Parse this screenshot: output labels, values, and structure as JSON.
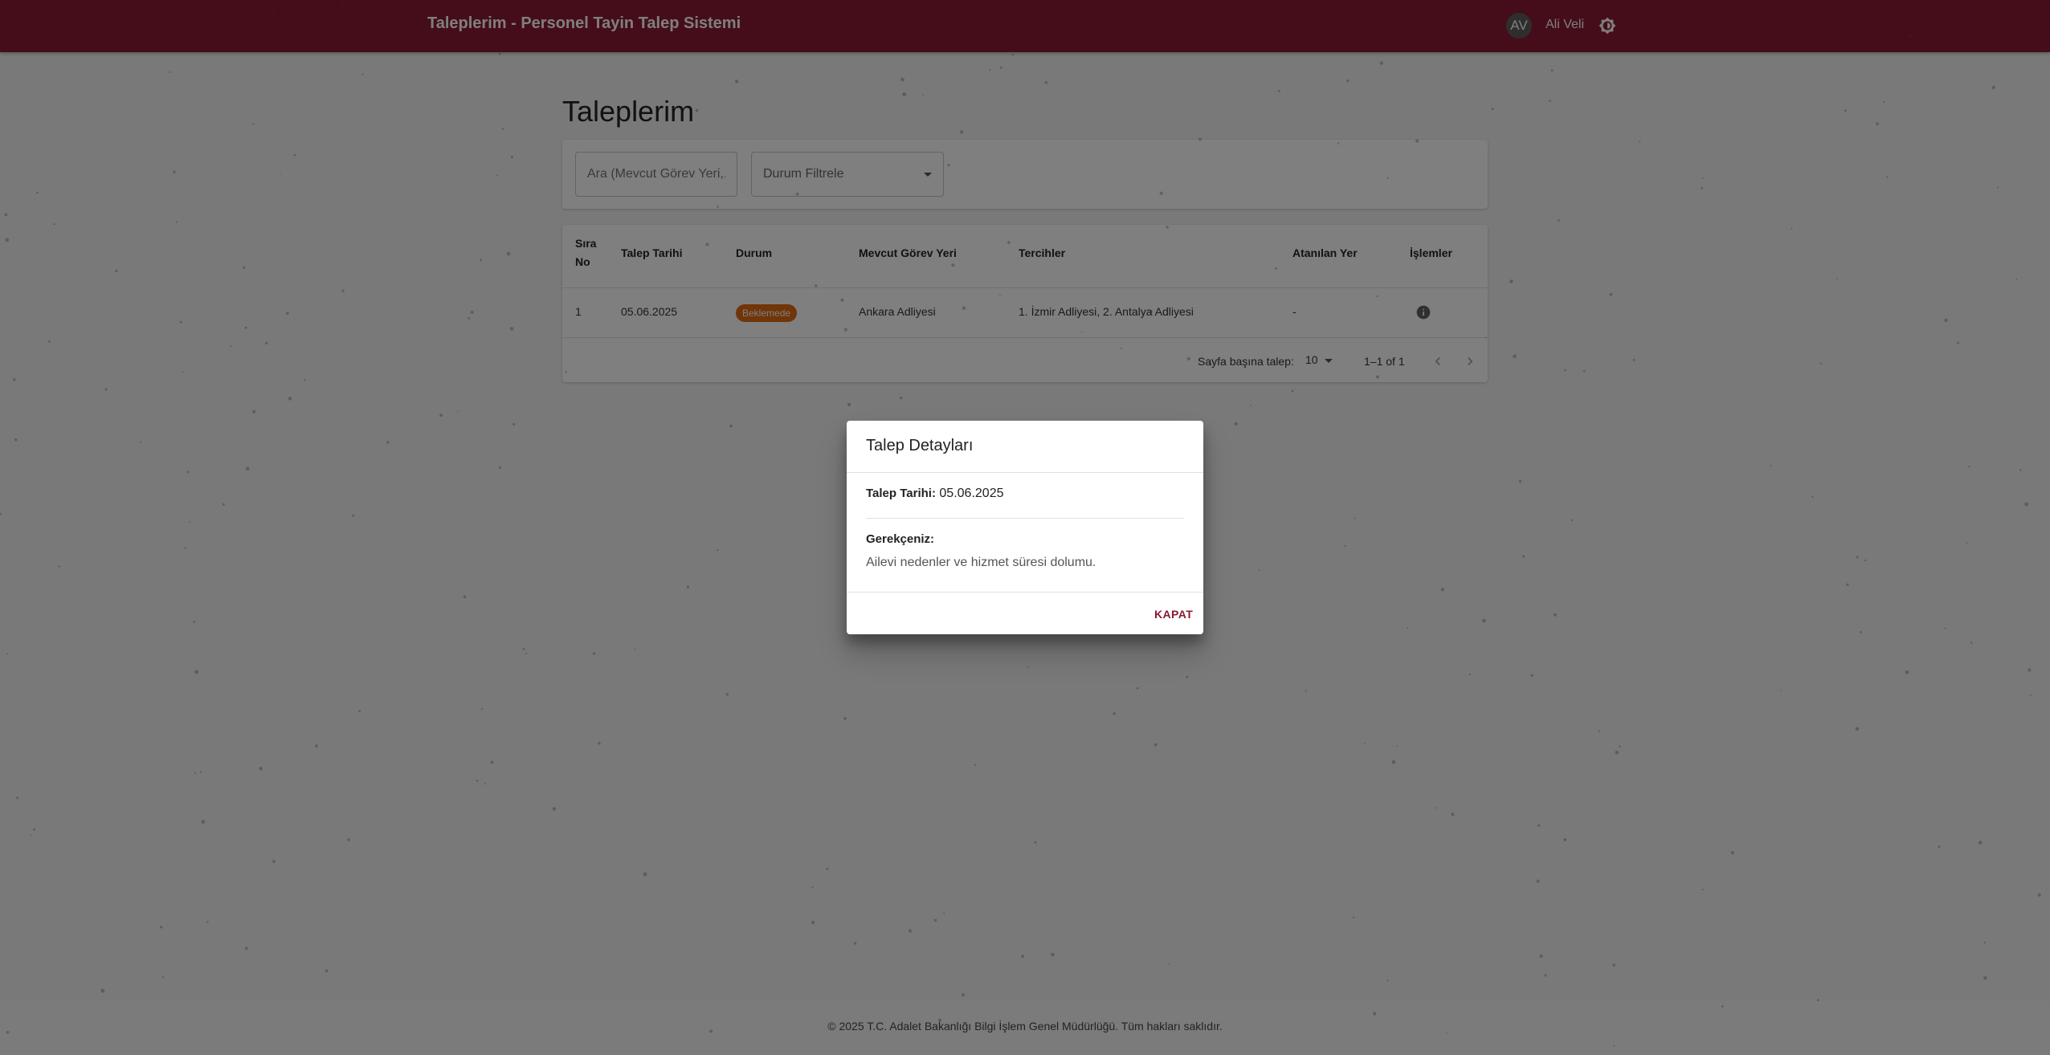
{
  "header": {
    "title": "Taleplerim - Personel Tayin Talep Sistemi",
    "avatar_initials": "AV",
    "user_name": "Ali Veli",
    "theme_icon": "brightness-icon"
  },
  "page": {
    "title": "Taleplerim"
  },
  "filters": {
    "search_placeholder": "Ara (Mevcut Görev Yeri,...",
    "status_label": "Durum Filtrele"
  },
  "table": {
    "columns": [
      "Sıra No",
      "Talep Tarihi",
      "Durum",
      "Mevcut Görev Yeri",
      "Tercihler",
      "Atanılan Yer",
      "İşlemler"
    ],
    "rows": [
      {
        "no": "1",
        "date": "05.06.2025",
        "status": "Beklemede",
        "current_place": "Ankara Adliyesi",
        "preferences": "1. İzmir Adliyesi, 2. Antalya Adliyesi",
        "assigned": "-"
      }
    ],
    "status_color": "#e06a10"
  },
  "pagination": {
    "rows_per_page_label": "Sayfa başına talep:",
    "rows_per_page": "10",
    "range": "1–1 of 1"
  },
  "dialog": {
    "title": "Talep Detayları",
    "date_label": "Talep Tarihi:",
    "date_value": "05.06.2025",
    "reason_label": "Gerekçeniz:",
    "reason_value": "Ailevi nedenler ve hizmet süresi dolumu.",
    "close_label": "KAPAT"
  },
  "footer": {
    "text": "© 2025 T.C. Adalet Bakanlığı Bilgi İşlem Genel Müdürlüğü. Tüm hakları saklıdır."
  },
  "colors": {
    "primary": "#8a1a33",
    "warning": "#e06a10"
  }
}
